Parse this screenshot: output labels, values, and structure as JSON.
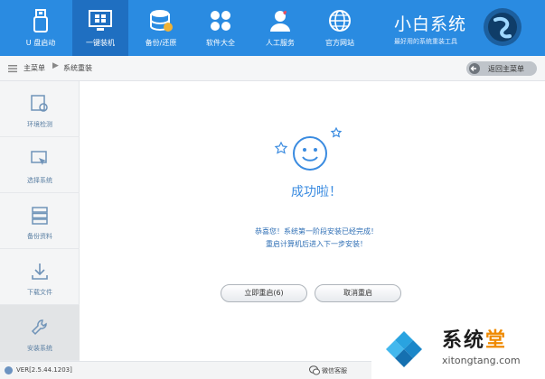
{
  "nav": {
    "items": [
      {
        "label": "U 盘启动",
        "icon": "usb-drive-icon"
      },
      {
        "label": "一键装机",
        "icon": "windows-icon",
        "active": true
      },
      {
        "label": "备份/还原",
        "icon": "database-backup-icon"
      },
      {
        "label": "软件大全",
        "icon": "apps-icon"
      },
      {
        "label": "人工服务",
        "icon": "user-heart-icon"
      },
      {
        "label": "官方网站",
        "icon": "globe-icon"
      }
    ],
    "brand": "小白系统",
    "brand_sub": "最好用的系统重装工具"
  },
  "breadcrumb": {
    "home": "主菜单",
    "separator": "▶",
    "current": "系统重装",
    "back_label": "返回主菜单"
  },
  "sidebar": {
    "items": [
      {
        "label": "环境检测",
        "icon": "environment-check-icon"
      },
      {
        "label": "选择系统",
        "icon": "select-system-icon"
      },
      {
        "label": "备份资料",
        "icon": "backup-data-icon"
      },
      {
        "label": "下载文件",
        "icon": "download-icon"
      },
      {
        "label": "安装系统",
        "icon": "wrench-icon",
        "active": true
      }
    ]
  },
  "main": {
    "title": "成功啦！",
    "message_line1": "恭喜您！系统第一阶段安装已经完成！",
    "message_line2": "重启计算机后进入下一步安装！",
    "restart_button": "立即重启(6)",
    "cancel_button": "取消重启"
  },
  "status": {
    "version": "VER[2.5.44.1203]",
    "wechat_label": "微信客服"
  },
  "watermark": {
    "title_part1": "系统",
    "title_part2": "堂",
    "url": "xitongtang.com"
  },
  "colors": {
    "accent": "#2a8be1",
    "active_tab": "#1f6fc1",
    "success_text": "#3a8be0"
  }
}
